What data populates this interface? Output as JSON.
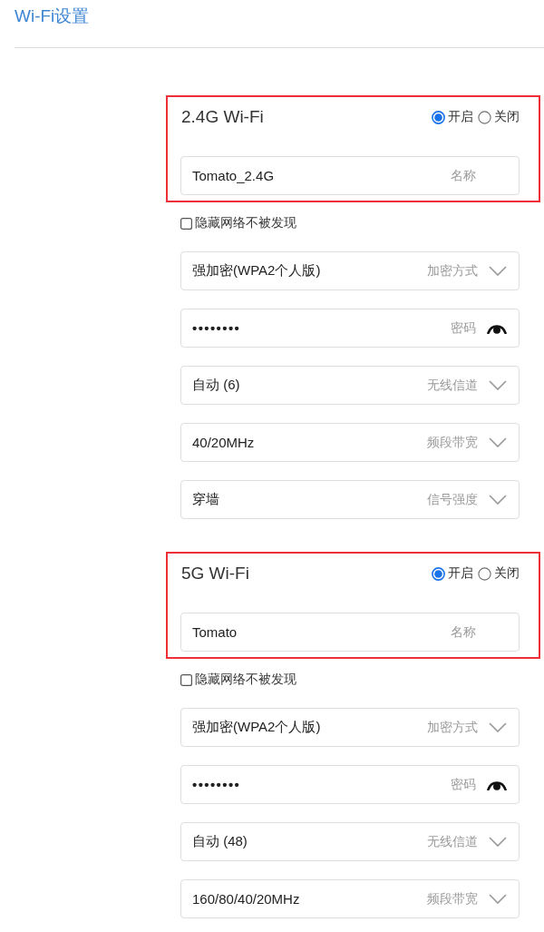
{
  "page": {
    "title": "Wi-Fi设置"
  },
  "bands": [
    {
      "title": "2.4G Wi-Fi",
      "highlighted": true,
      "radios": [
        {
          "label": "开启",
          "selected": true
        },
        {
          "label": "关闭",
          "selected": false
        }
      ],
      "name_field": {
        "kind": "text",
        "value": "Tomato_2.4G",
        "label": "名称"
      },
      "hide_network": {
        "label": "隐藏网络不被发现",
        "checked": false
      },
      "fields": [
        {
          "kind": "select",
          "value": "强加密(WPA2个人版)",
          "label": "加密方式"
        },
        {
          "kind": "password",
          "value": "••••••••",
          "label": "密码"
        },
        {
          "kind": "select",
          "value": "自动 (6)",
          "label": "无线信道"
        },
        {
          "kind": "select",
          "value": "40/20MHz",
          "label": "频段带宽"
        },
        {
          "kind": "select",
          "value": "穿墙",
          "label": "信号强度"
        }
      ]
    },
    {
      "title": "5G Wi-Fi",
      "highlighted": true,
      "radios": [
        {
          "label": "开启",
          "selected": true
        },
        {
          "label": "关闭",
          "selected": false
        }
      ],
      "name_field": {
        "kind": "text",
        "value": "Tomato",
        "label": "名称"
      },
      "hide_network": {
        "label": "隐藏网络不被发现",
        "checked": false
      },
      "fields": [
        {
          "kind": "select",
          "value": "强加密(WPA2个人版)",
          "label": "加密方式"
        },
        {
          "kind": "password",
          "value": "••••••••",
          "label": "密码"
        },
        {
          "kind": "select",
          "value": "自动 (48)",
          "label": "无线信道"
        },
        {
          "kind": "select",
          "value": "160/80/40/20MHz",
          "label": "频段带宽"
        }
      ]
    }
  ]
}
